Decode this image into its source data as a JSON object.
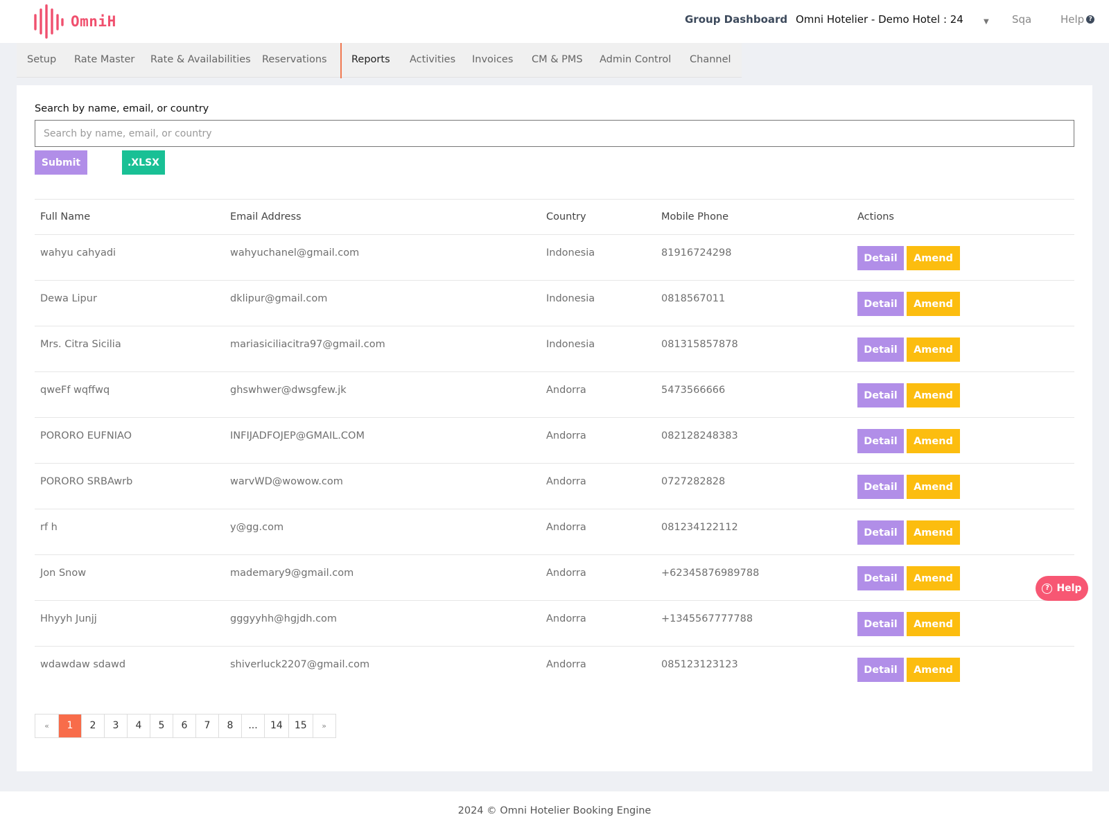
{
  "brand": {
    "name": "OmniH",
    "color": "#f0506e"
  },
  "header": {
    "group_dashboard": "Group Dashboard",
    "hotel_selector": "Omni Hotelier - Demo Hotel : 24",
    "user": "Sqa",
    "help": "Help"
  },
  "nav": {
    "items": [
      {
        "label": "Setup"
      },
      {
        "label": "Rate Master"
      },
      {
        "label": "Rate & Availabilities"
      },
      {
        "label": "Reservations"
      },
      {
        "label": "Reports"
      },
      {
        "label": "Activities"
      },
      {
        "label": "Invoices"
      },
      {
        "label": "CM & PMS"
      },
      {
        "label": "Admin Control"
      },
      {
        "label": "Channel"
      }
    ],
    "active": "Reports"
  },
  "search": {
    "label": "Search by name, email, or country",
    "placeholder": "Search by name, email, or country",
    "value": "",
    "submit_label": "Submit",
    "export_label": ".XLSX"
  },
  "table": {
    "headers": {
      "name": "Full Name",
      "email": "Email Address",
      "country": "Country",
      "phone": "Mobile Phone",
      "actions": "Actions"
    },
    "detail_label": "Detail",
    "amend_label": "Amend",
    "rows": [
      {
        "name": "wahyu cahyadi",
        "email": "wahyuchanel@gmail.com",
        "country": "Indonesia",
        "phone": "81916724298"
      },
      {
        "name": "Dewa Lipur",
        "email": "dklipur@gmail.com",
        "country": "Indonesia",
        "phone": "0818567011"
      },
      {
        "name": "Mrs. Citra Sicilia",
        "email": "mariasiciliacitra97@gmail.com",
        "country": "Indonesia",
        "phone": "081315857878"
      },
      {
        "name": "qweFf wqffwq",
        "email": "ghswhwer@dwsgfew.jk",
        "country": "Andorra",
        "phone": "5473566666"
      },
      {
        "name": "PORORO EUFNIAO",
        "email": "INFIJADFOJEP@GMAIL.COM",
        "country": "Andorra",
        "phone": "082128248383"
      },
      {
        "name": "PORORO SRBAwrb",
        "email": "warvWD@wowow.com",
        "country": "Andorra",
        "phone": "0727282828"
      },
      {
        "name": "rf h",
        "email": "y@gg.com",
        "country": "Andorra",
        "phone": "081234122112"
      },
      {
        "name": "Jon Snow",
        "email": "mademary9@gmail.com",
        "country": "Andorra",
        "phone": "+62345876989788"
      },
      {
        "name": "Hhyyh Junjj",
        "email": "gggyyhh@hgjdh.com",
        "country": "Andorra",
        "phone": "+1345567777788"
      },
      {
        "name": "wdawdaw sdawd",
        "email": "shiverluck2207@gmail.com",
        "country": "Andorra",
        "phone": "085123123123"
      }
    ]
  },
  "pagination": {
    "pages": [
      "«",
      "1",
      "2",
      "3",
      "4",
      "5",
      "6",
      "7",
      "8",
      "...",
      "14",
      "15",
      "»"
    ],
    "current": "1"
  },
  "floating_help": {
    "label": "Help"
  },
  "footer": {
    "text": "2024 © Omni Hotelier Booking Engine"
  },
  "colors": {
    "detail": "#b18ee8",
    "amend": "#fcbd0f",
    "export": "#19c095",
    "active_page": "#f86c4a",
    "floating_help": "#f75773"
  }
}
